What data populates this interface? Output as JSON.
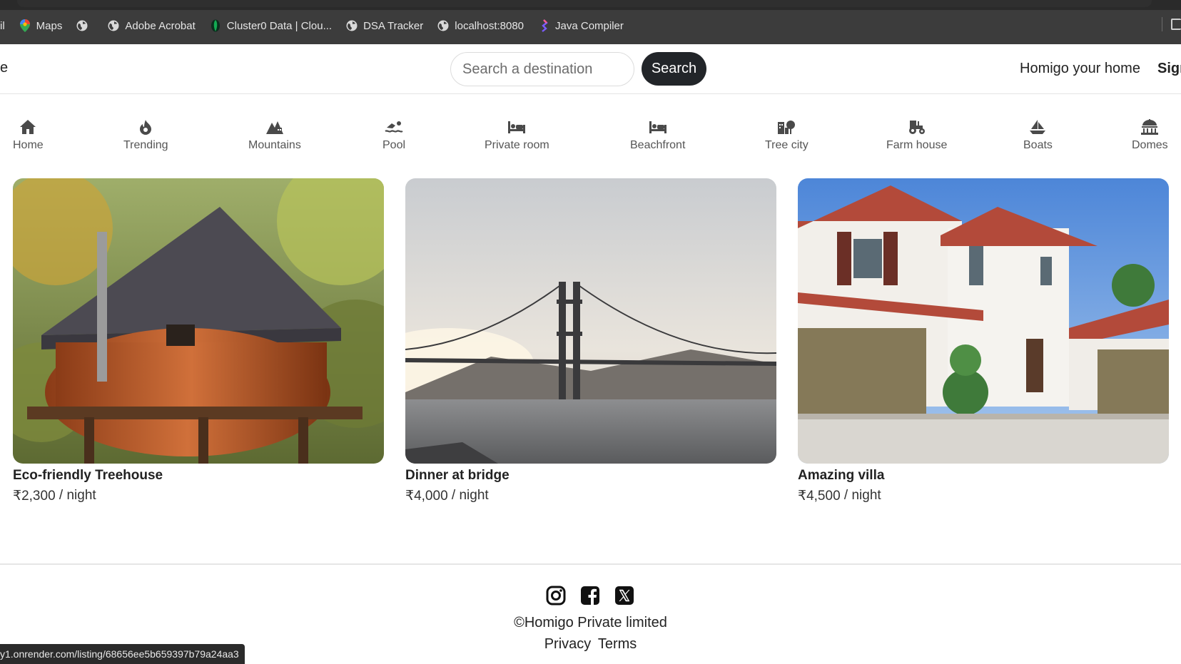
{
  "browser": {
    "bookmarks": [
      {
        "label": "il",
        "icon": "mail-icon"
      },
      {
        "label": "Maps",
        "icon": "maps-icon"
      },
      {
        "label": "",
        "icon": "globe-icon"
      },
      {
        "label": "Adobe Acrobat",
        "icon": "globe-icon"
      },
      {
        "label": "Cluster0 Data | Clou...",
        "icon": "mongodb-leaf-icon"
      },
      {
        "label": "DSA Tracker",
        "icon": "globe-icon"
      },
      {
        "label": "localhost:8080",
        "icon": "globe-icon"
      },
      {
        "label": "Java Compiler",
        "icon": "compiler-icon"
      }
    ],
    "status_url": "y1.onrender.com/listing/68656ee5b659397b79a24aa3"
  },
  "navbar": {
    "brand_partial": "e",
    "search_placeholder": "Search a destination",
    "search_button": "Search",
    "host_link": "Homigo your home",
    "signup_link": "Sign"
  },
  "filters": [
    {
      "label": "Home",
      "icon": "house-icon"
    },
    {
      "label": "Trending",
      "icon": "fire-icon"
    },
    {
      "label": "Mountains",
      "icon": "mountain-city-icon"
    },
    {
      "label": "Pool",
      "icon": "swimmer-icon"
    },
    {
      "label": "Private room",
      "icon": "bed-icon"
    },
    {
      "label": "Beachfront",
      "icon": "bed-icon"
    },
    {
      "label": "Tree city",
      "icon": "tree-city-icon"
    },
    {
      "label": "Farm house",
      "icon": "tractor-icon"
    },
    {
      "label": "Boats",
      "icon": "sailboat-icon"
    },
    {
      "label": "Domes",
      "icon": "dome-icon"
    }
  ],
  "listings": [
    {
      "title": "Eco-friendly Treehouse",
      "price": "₹2,300",
      "unit": "/ night",
      "image": "treehouse-photo"
    },
    {
      "title": "Dinner at bridge",
      "price": "₹4,000",
      "unit": "/ night",
      "image": "bridge-photo"
    },
    {
      "title": "Amazing villa",
      "price": "₹4,500",
      "unit": "/ night",
      "image": "villa-photo"
    }
  ],
  "footer": {
    "socials": [
      "instagram-icon",
      "facebook-icon",
      "x-twitter-icon"
    ],
    "copyright": "©Homigo Private limited",
    "privacy": "Privacy",
    "terms": "Terms"
  }
}
